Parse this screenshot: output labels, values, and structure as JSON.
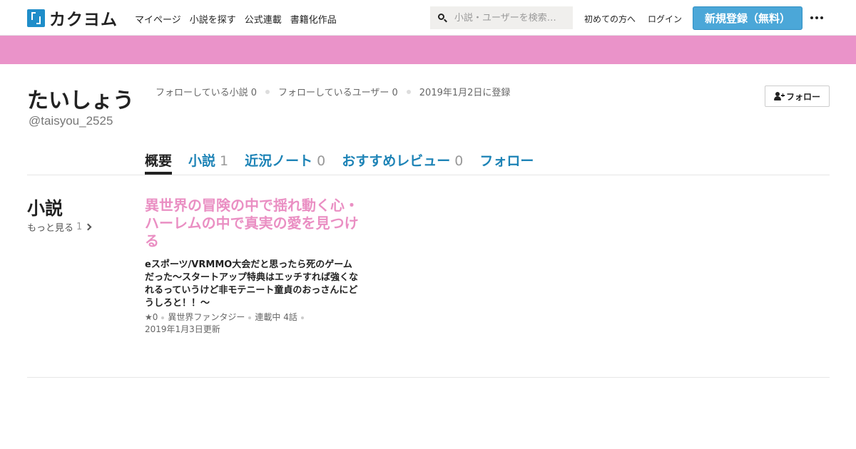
{
  "header": {
    "logo_text": "カクヨム",
    "nav": [
      "マイページ",
      "小説を探す",
      "公式連載",
      "書籍化作品"
    ],
    "search_placeholder": "小説・ユーザーを検索…",
    "first_time_label": "初めての方へ",
    "login_label": "ログイン",
    "signup_label": "新規登録（無料）",
    "more_icon": "more-horizontal-icon"
  },
  "banner": {
    "color": "#ea93c9"
  },
  "profile": {
    "name": "たいしょう",
    "handle": "@taisyou_2525",
    "stats": {
      "following_novels": "フォローしている小説 0",
      "following_users": "フォローしているユーザー 0",
      "registered": "2019年1月2日に登録"
    },
    "follow_label": "フォロー"
  },
  "tabs": [
    {
      "label": "概要",
      "count": ""
    },
    {
      "label": "小説",
      "count": "1"
    },
    {
      "label": "近況ノート",
      "count": "0"
    },
    {
      "label": "おすすめレビュー",
      "count": "0"
    },
    {
      "label": "フォロー",
      "count": ""
    }
  ],
  "works": {
    "section_title": "小説",
    "see_more_label": "もっと見る",
    "see_more_count": "1",
    "items": [
      {
        "title": "異世界の冒険の中で揺れ動く心・ハーレムの中で真実の愛を見つける",
        "catchphrase": "eスポーツ/VRMMO大会だと思ったら死のゲームだった～スタートアップ特典はエッチすれば強くなれるっていうけど非モテニート童貞のおっさんにどうしろと！！～",
        "stars": "★0",
        "genre": "異世界ファンタジー",
        "status": "連載中 4話",
        "updated": "2019年1月3日更新"
      }
    ]
  },
  "colors": {
    "accent": "#1d83b6",
    "signup": "#4ba7d8",
    "work_title": "#ea8fc3"
  }
}
